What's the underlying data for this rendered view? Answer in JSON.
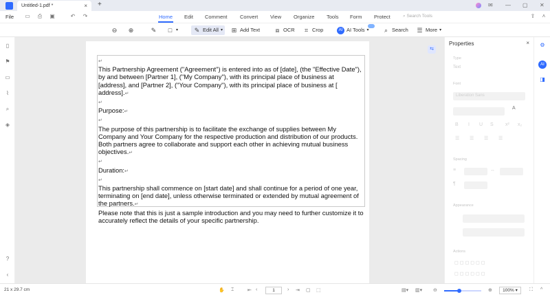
{
  "window": {
    "tab_title": "Untitled-1.pdf *",
    "tab_close": "×",
    "new_tab": "+"
  },
  "menubar": {
    "file": "File",
    "items": [
      "Home",
      "Edit",
      "Comment",
      "Convert",
      "View",
      "Organize",
      "Tools",
      "Form",
      "Protect"
    ],
    "active": "Home",
    "search_placeholder": "Search Tools"
  },
  "toolbar": {
    "edit_all": "Edit All",
    "add_text": "Add Text",
    "ocr": "OCR",
    "crop": "Crop",
    "ai_tools": "AI Tools",
    "search": "Search",
    "more": "More"
  },
  "document": {
    "paragraphs": [
      {
        "text": "",
        "mark": "↵"
      },
      {
        "text": "This Partnership Agreement (\"Agreement\") is entered into as of [date], (the \"Effective Date\"), by and between [Partner 1], (\"My Company\"), with its principal place of business at [address], and [Partner 2], (\"Your Company\"), with its principal place of business at [ address].",
        "mark": "↵"
      },
      {
        "text": "",
        "mark": "↵"
      },
      {
        "text": "Purpose:",
        "mark": "↵"
      },
      {
        "text": "",
        "mark": "↵"
      },
      {
        "text": "The purpose of this partnership is to facilitate the exchange of supplies between My Company and Your Company for the respective production and distribution of our products. Both partners agree to collaborate and support each other in achieving mutual business objectives.",
        "mark": "↵"
      },
      {
        "text": "",
        "mark": "↵"
      },
      {
        "text": "Duration:",
        "mark": "↵"
      },
      {
        "text": "",
        "mark": "↵"
      },
      {
        "text": "This partnership shall commence on [start date] and shall continue for a period of one year, terminating on [end date], unless otherwise terminated or extended by mutual agreement of the partners.",
        "mark": "↵"
      },
      {
        "text": "Please note that this is just a sample introduction and you may need to further customize it to accurately reflect the details of your specific partnership.",
        "mark": ""
      }
    ]
  },
  "properties": {
    "title": "Properties",
    "close": "×",
    "sections": [
      "Type",
      "Font",
      "Spacing",
      "Appearance",
      "Actions"
    ],
    "type_value": "Text",
    "font_value": "Liberation Sans"
  },
  "statusbar": {
    "page_size": "21 x 29.7 cm",
    "page_number": "1",
    "zoom": "100%",
    "zoom_level": 0.4
  },
  "colors": {
    "accent": "#2f6bff",
    "canvas": "#ebebeb"
  }
}
